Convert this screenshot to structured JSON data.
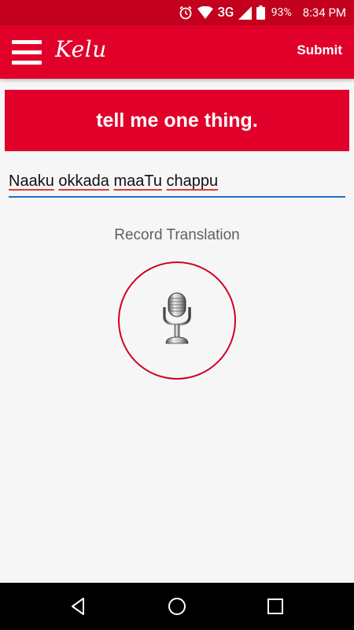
{
  "status_bar": {
    "network": "3G",
    "battery": "93%",
    "time": "8:34 PM"
  },
  "app_bar": {
    "logo": "Kelu",
    "submit_label": "Submit"
  },
  "prompt": {
    "text": "tell me one thing."
  },
  "translation": {
    "words": [
      "Naaku",
      "okkada",
      "maaTu",
      "chappu"
    ]
  },
  "record": {
    "label": "Record Translation"
  },
  "colors": {
    "brand_red": "#e0002a",
    "status_red": "#c3001e",
    "input_underline": "#1e6fc8",
    "record_ring": "#cf0024"
  },
  "icons": {
    "menu": "hamburger-menu-icon",
    "alarm": "alarm-icon",
    "wifi": "wifi-icon",
    "signal": "cell-signal-icon",
    "battery": "battery-icon",
    "microphone": "microphone-icon",
    "back": "back-icon",
    "home": "home-icon",
    "recent": "recent-apps-icon"
  }
}
